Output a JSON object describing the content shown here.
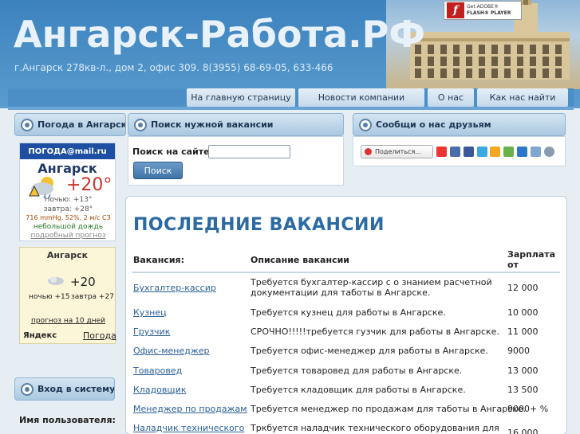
{
  "header": {
    "title": "Ангарск-Работа.РФ",
    "address": "г.Ангарск 278кв-л., дом 2, офис 309. 8(3955) 68-69-05, 633-466",
    "flash_badge": {
      "line1": "Get ADOBE®",
      "line2": "FLASH® PLAYER"
    }
  },
  "nav": {
    "items": [
      {
        "label": "На главную страницу"
      },
      {
        "label": "Новости компании"
      },
      {
        "label": "О нас"
      },
      {
        "label": "Как нас найти"
      }
    ]
  },
  "sidebar": {
    "weather_title": "Погода в Ангарске",
    "weather_mail": {
      "logo": "ПОГОДА@mail.ru",
      "city": "Ангарск",
      "temp": "+20°",
      "night": "Ночью: +13°",
      "tomorrow": "завтра: +28°",
      "details": "716 mmHg, 52%, 2 м/с СЗ",
      "condition": "небольшой дождь",
      "more_link": "подробный прогноз"
    },
    "weather_yandex": {
      "city": "Ангарск",
      "temp": "+20",
      "night": "ночью +15",
      "tomorrow": "завтра +27",
      "forecast_link": "прогноз на 10 дней",
      "brand": "Яндекс",
      "weather_link": "Погода"
    },
    "login_title": "Вход в систему",
    "username_label": "Имя пользователя:"
  },
  "search": {
    "title": "Поиск нужной вакансии",
    "label": "Поиск на сайте:",
    "value": "",
    "button": "Поиск"
  },
  "social": {
    "title": "Сообщи о нас друзьям",
    "share_label": "Поделиться..."
  },
  "vacancies": {
    "heading": "ПОСЛЕДНИЕ ВАКАНСИИ",
    "columns": [
      "Вакансия:",
      "Описание вакансии",
      "Зарплата",
      "от"
    ],
    "rows": [
      {
        "name": "Бухгалтер-кассир",
        "desc1": "Требуется бухгалтер-кассир с о знанием расчетной",
        "desc2": "документации для таботы в Ангарске.",
        "salary": "12 000"
      },
      {
        "name": "Кузнец",
        "desc1": "Требуется кузнец для работы в Ангарске.",
        "desc2": "",
        "salary": "10 000"
      },
      {
        "name": "Грузчик",
        "desc1": "СРОЧНО!!!!!требуется гузчик для работы в Ангарске.",
        "desc2": "",
        "salary": "11 000"
      },
      {
        "name": "Офис-менеджер",
        "desc1": "Требуется офис-менеджер для работы в Ангарске.",
        "desc2": "",
        "salary": "9000"
      },
      {
        "name": "Товаровед",
        "desc1": "Требуется товаровед для работы в Ангарске.",
        "desc2": "",
        "salary": "13 000"
      },
      {
        "name": "Кладовщик",
        "desc1": "Требуется кладовщик для работы в Ангарске.",
        "desc2": "",
        "salary": "13 500"
      },
      {
        "name": "Менеджер по продажам",
        "desc1": "Требуется менеджер по продажам для таботы в Ангарске.",
        "desc2": "",
        "salary": "9000+ %"
      },
      {
        "name": "Наладчик технического",
        "desc1": "Тркбуется наладчик технического оборудования для",
        "desc2": "",
        "salary": "16 000"
      }
    ]
  },
  "colors": {
    "accent": "#2b6aa2",
    "header_bg": "#4c8fc6",
    "link": "#2a5f96"
  }
}
